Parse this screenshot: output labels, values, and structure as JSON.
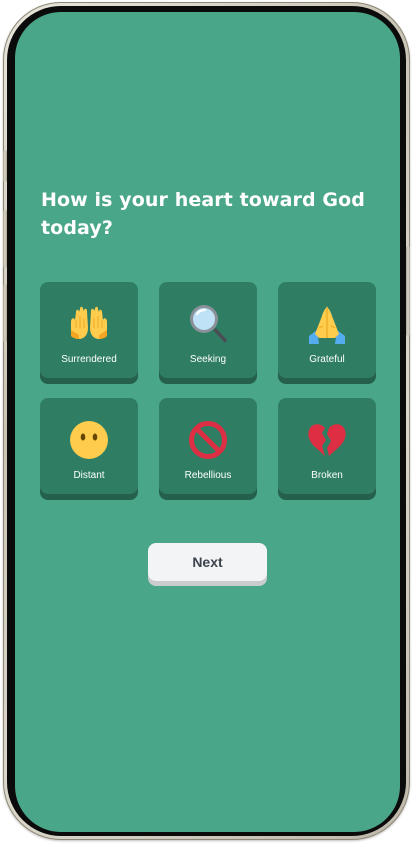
{
  "question": {
    "text": "How is your heart toward God today?"
  },
  "options": [
    {
      "label": "Surrendered",
      "icon": "raised-palms-icon"
    },
    {
      "label": "Seeking",
      "icon": "magnifying-glass-icon"
    },
    {
      "label": "Grateful",
      "icon": "folded-hands-icon"
    },
    {
      "label": "Distant",
      "icon": "face-without-mouth-icon"
    },
    {
      "label": "Rebellious",
      "icon": "prohibited-icon"
    },
    {
      "label": "Broken",
      "icon": "broken-heart-icon"
    }
  ],
  "actions": {
    "next_label": "Next"
  },
  "colors": {
    "screen_background": "#4aa688",
    "card_background": "#2f7e63",
    "card_shadow": "#25604c",
    "button_background": "#f2f4f5",
    "button_text": "#3b434c"
  }
}
